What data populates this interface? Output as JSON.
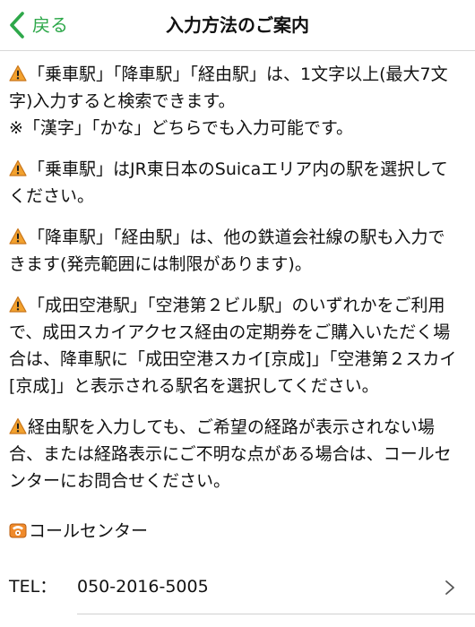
{
  "nav": {
    "back_label": "戻る",
    "title": "入力方法のご案内",
    "accent_color": "#2ea84a"
  },
  "notes": [
    {
      "icon": "warning-icon",
      "text": "「乗車駅」「降車駅」「経由駅」は、1文字以上(最大7文字)入力すると検索できます。",
      "subtext": "※「漢字」「かな」どちらでも入力可能です。"
    },
    {
      "icon": "warning-icon",
      "text": "「乗車駅」はJR東日本のSuicaエリア内の駅を選択してください。"
    },
    {
      "icon": "warning-icon",
      "text": "「降車駅」「経由駅」は、他の鉄道会社線の駅も入力できます(発売範囲には制限があります)。"
    },
    {
      "icon": "warning-icon",
      "text": "「成田空港駅」「空港第２ビル駅」のいずれかをご利用で、成田スカイアクセス経由の定期券をご購入いただく場合は、降車駅に「成田空港スカイ[京成]」「空港第２スカイ[京成]」と表示される駅名を選択してください。"
    },
    {
      "icon": "warning-icon",
      "text": "経由駅を入力しても、ご希望の経路が表示されない場合、または経路表示にご不明な点がある場合は、コールセンターにお問合せください。"
    }
  ],
  "contact": {
    "icon": "phone-icon",
    "heading": "コールセンター",
    "tel_label": "TEL：",
    "tel_number": "050-2016-5005"
  }
}
